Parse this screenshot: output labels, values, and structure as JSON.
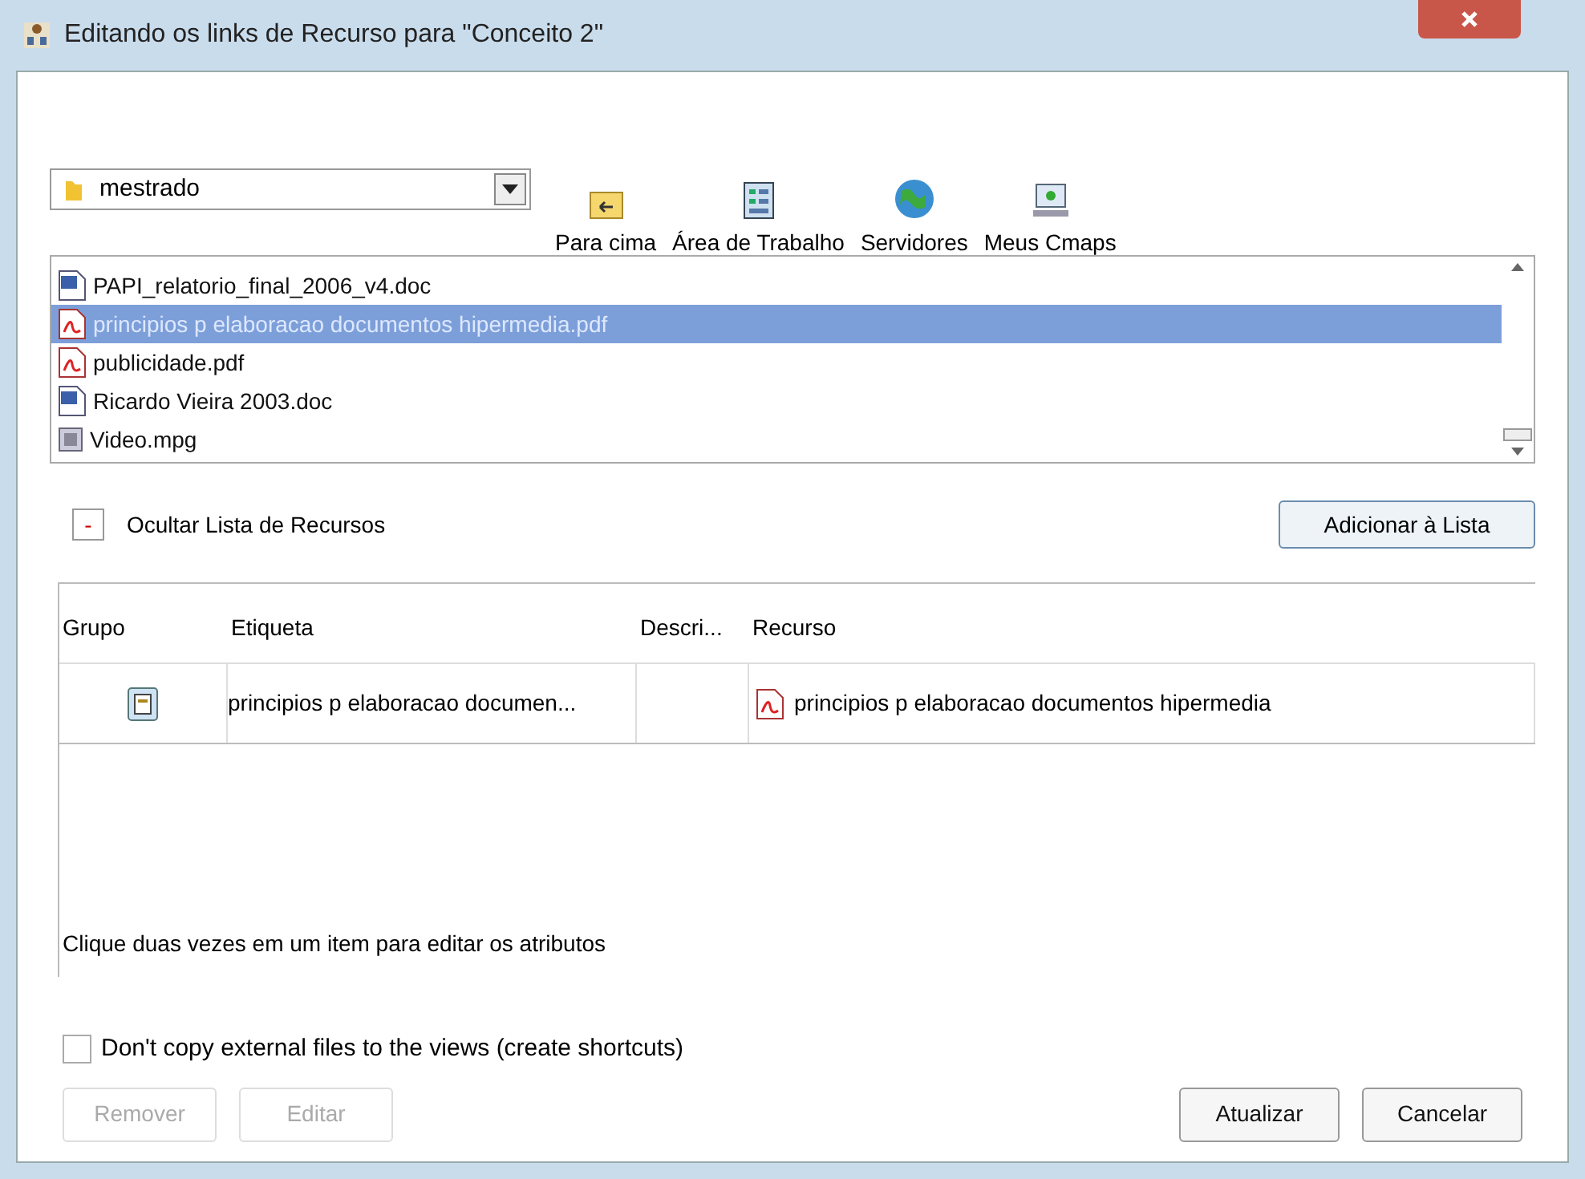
{
  "window": {
    "title": "Editando os links de Recurso para \"Conceito 2\""
  },
  "folder": {
    "value": "mestrado"
  },
  "toolbar": [
    {
      "label": "Para cima",
      "kind": "up"
    },
    {
      "label": "Área de Trabalho",
      "kind": "desktop"
    },
    {
      "label": "Servidores",
      "kind": "servers"
    },
    {
      "label": "Meus Cmaps",
      "kind": "cmaps"
    }
  ],
  "files": [
    {
      "name": "PAPI_relatorio_final_2006_v4.doc",
      "kind": "doc",
      "selected": false
    },
    {
      "name": "principios p elaboracao documentos hipermedia.pdf",
      "kind": "pdf",
      "selected": true
    },
    {
      "name": "publicidade.pdf",
      "kind": "pdf",
      "selected": false
    },
    {
      "name": "Ricardo Vieira 2003.doc",
      "kind": "doc",
      "selected": false
    },
    {
      "name": "Video.mpg",
      "kind": "video",
      "selected": false
    }
  ],
  "toggle": {
    "symbol": "-",
    "label": "Ocultar Lista de Recursos"
  },
  "add_button": "Adicionar à Lista",
  "table": {
    "columns": [
      "Grupo",
      "Etiqueta",
      "Descri...",
      "Recurso"
    ],
    "rows": [
      {
        "etiqueta": "principios p elaboracao documen...",
        "recurso": "principios p elaboracao documentos hipermedia",
        "kind": "pdf"
      }
    ]
  },
  "hint": "Clique duas vezes em um item para editar os atributos",
  "shortcuts": {
    "label": "Don't copy external files to the views (create shortcuts)",
    "checked": false
  },
  "buttons": [
    {
      "label": "Remover",
      "disabled": true
    },
    {
      "label": "Editar",
      "disabled": true
    },
    {
      "label": "Atualizar",
      "disabled": false
    },
    {
      "label": "Cancelar",
      "disabled": false
    }
  ]
}
